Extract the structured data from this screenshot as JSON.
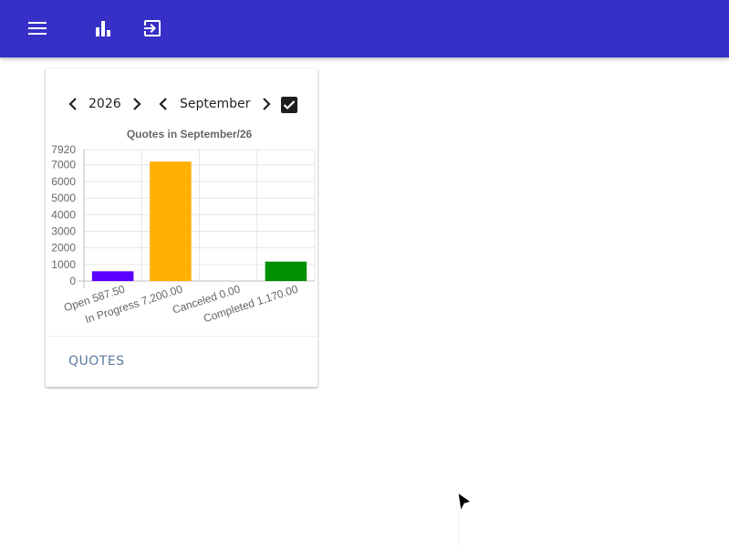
{
  "appbar": {
    "background": "#3730c7",
    "icons": [
      "menu-icon",
      "bar-chart-icon",
      "exit-to-app-icon"
    ]
  },
  "filters": {
    "year": "2026",
    "month": "September",
    "checked": true
  },
  "chart_data": {
    "type": "bar",
    "title": "Quotes in September/26",
    "categories": [
      "Open 587.50",
      "In Progress 7,200.00",
      "Canceled 0.00",
      "Completed 1,170.00"
    ],
    "values": [
      587.5,
      7200,
      0,
      1170
    ],
    "colors": [
      "#5a00ff",
      "#ffb000",
      "#e03030",
      "#009000"
    ],
    "ylim": [
      0,
      7920
    ],
    "yticks": [
      0,
      1000,
      2000,
      3000,
      4000,
      5000,
      6000,
      7000,
      7920
    ],
    "grid": true,
    "legend": "none"
  },
  "card": {
    "action_label": "QUOTES"
  }
}
